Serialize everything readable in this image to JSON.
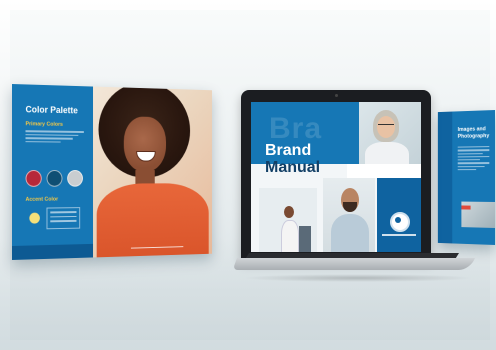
{
  "left_panel": {
    "title": "Color Palette",
    "primary_heading": "Primary Colors",
    "accent_heading": "Accent Color",
    "primary_colors": [
      "#b7283a",
      "#0f4f74",
      "#c9cdd0"
    ],
    "accent_color": "#f4e07a"
  },
  "laptop_screen": {
    "watermark": "Bra",
    "title_line1": "Brand",
    "title_line2": "Manual"
  },
  "right_panel": {
    "title": "Images and Photography"
  },
  "colors": {
    "brand_blue": "#1677b5",
    "dark_blue": "#0f63a0",
    "navy": "#123f66",
    "accent_yellow": "#f6c945",
    "accent_orange": "#e8673a"
  }
}
